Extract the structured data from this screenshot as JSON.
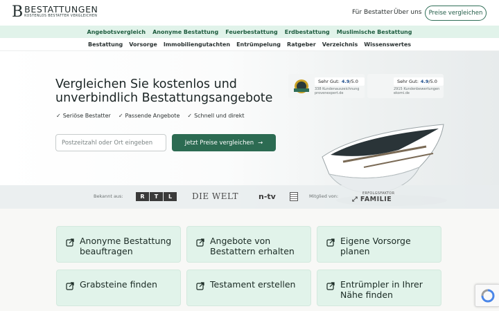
{
  "logo": {
    "letter": "B",
    "name": "BESTATTUNGEN",
    "tagline": "KOSTENLOS BESTATTER VERGLEICHEN"
  },
  "header_nav": {
    "for_undertakers": "Für Bestatter",
    "about": "Über uns",
    "cta": "Preise vergleichen"
  },
  "primary_nav": [
    "Angebotsvergleich",
    "Anonyme Bestattung",
    "Feuerbestattung",
    "Erdbestattung",
    "Muslimische Bestattung"
  ],
  "secondary_nav": [
    "Bestattung",
    "Vorsorge",
    "Immobiliengutachten",
    "Entrümpelung",
    "Ratgeber",
    "Verzeichnis",
    "Wissenswertes"
  ],
  "hero": {
    "headline_line1": "Vergleichen Sie kostenlos und",
    "headline_line2": "unverbindlich Bestattungsangebote",
    "checks": [
      "Seriöse Bestatter",
      "Passende Angebote",
      "Schnell und direkt"
    ],
    "input_placeholder": "Postzeitzahl oder Ort eingeben",
    "button_label": "Jetzt Preise vergleichen"
  },
  "ratings": [
    {
      "label": "Sehr Gut:",
      "score": "4.9",
      "max": "/5.0",
      "count_text": "338 Kundenauszeichnung",
      "source": "provenexpert.de"
    },
    {
      "label": "Sehr Gut:",
      "score": "4.9",
      "max": "/5.0",
      "count_text": "2915 Kundenbewertungen",
      "source": "ekomi.de"
    }
  ],
  "press": {
    "known_from": "Bekannt aus:",
    "rtl": [
      "R",
      "T",
      "L"
    ],
    "welt": "DIE WELT",
    "ntv": "n-tv",
    "member_of": "Mitglied von:",
    "family_top": "ERFOLGSFAKTOR",
    "family_bottom": "FAMILIE"
  },
  "cards": [
    "Anonyme Bestattung beauftragen",
    "Angebote von Bestattern erhalten",
    "Eigene Vorsorge planen",
    "Grabsteine finden",
    "Testament erstellen",
    "Entrümpler in Ihrer Nähe finden"
  ],
  "colors": {
    "accent": "#2c6b52",
    "nav_bg": "#e1f3ea",
    "card_bg": "#e1f3ea"
  },
  "icons": {
    "card_icon": "external-link-icon",
    "check": "check-icon",
    "arrow": "arrow-right-icon"
  }
}
